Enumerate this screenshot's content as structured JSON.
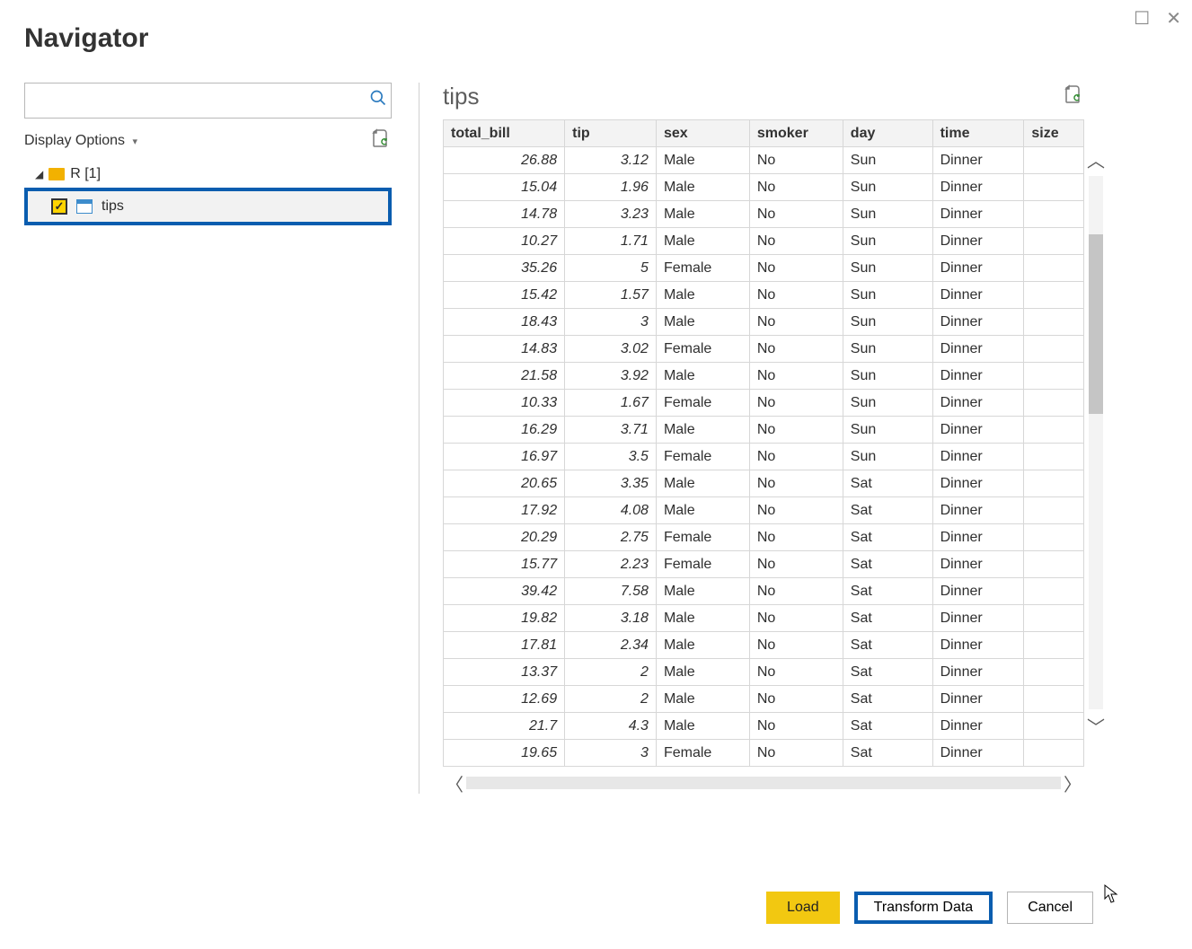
{
  "window": {
    "title": "Navigator"
  },
  "left": {
    "display_options_label": "Display Options",
    "root_label": "R [1]",
    "child_label": "tips",
    "child_checked": true
  },
  "preview": {
    "title": "tips",
    "columns": [
      "total_bill",
      "tip",
      "sex",
      "smoker",
      "day",
      "time",
      "size"
    ],
    "rows": [
      {
        "total_bill": "26.88",
        "tip": "3.12",
        "sex": "Male",
        "smoker": "No",
        "day": "Sun",
        "time": "Dinner",
        "size": ""
      },
      {
        "total_bill": "15.04",
        "tip": "1.96",
        "sex": "Male",
        "smoker": "No",
        "day": "Sun",
        "time": "Dinner",
        "size": ""
      },
      {
        "total_bill": "14.78",
        "tip": "3.23",
        "sex": "Male",
        "smoker": "No",
        "day": "Sun",
        "time": "Dinner",
        "size": ""
      },
      {
        "total_bill": "10.27",
        "tip": "1.71",
        "sex": "Male",
        "smoker": "No",
        "day": "Sun",
        "time": "Dinner",
        "size": ""
      },
      {
        "total_bill": "35.26",
        "tip": "5",
        "sex": "Female",
        "smoker": "No",
        "day": "Sun",
        "time": "Dinner",
        "size": ""
      },
      {
        "total_bill": "15.42",
        "tip": "1.57",
        "sex": "Male",
        "smoker": "No",
        "day": "Sun",
        "time": "Dinner",
        "size": ""
      },
      {
        "total_bill": "18.43",
        "tip": "3",
        "sex": "Male",
        "smoker": "No",
        "day": "Sun",
        "time": "Dinner",
        "size": ""
      },
      {
        "total_bill": "14.83",
        "tip": "3.02",
        "sex": "Female",
        "smoker": "No",
        "day": "Sun",
        "time": "Dinner",
        "size": ""
      },
      {
        "total_bill": "21.58",
        "tip": "3.92",
        "sex": "Male",
        "smoker": "No",
        "day": "Sun",
        "time": "Dinner",
        "size": ""
      },
      {
        "total_bill": "10.33",
        "tip": "1.67",
        "sex": "Female",
        "smoker": "No",
        "day": "Sun",
        "time": "Dinner",
        "size": ""
      },
      {
        "total_bill": "16.29",
        "tip": "3.71",
        "sex": "Male",
        "smoker": "No",
        "day": "Sun",
        "time": "Dinner",
        "size": ""
      },
      {
        "total_bill": "16.97",
        "tip": "3.5",
        "sex": "Female",
        "smoker": "No",
        "day": "Sun",
        "time": "Dinner",
        "size": ""
      },
      {
        "total_bill": "20.65",
        "tip": "3.35",
        "sex": "Male",
        "smoker": "No",
        "day": "Sat",
        "time": "Dinner",
        "size": ""
      },
      {
        "total_bill": "17.92",
        "tip": "4.08",
        "sex": "Male",
        "smoker": "No",
        "day": "Sat",
        "time": "Dinner",
        "size": ""
      },
      {
        "total_bill": "20.29",
        "tip": "2.75",
        "sex": "Female",
        "smoker": "No",
        "day": "Sat",
        "time": "Dinner",
        "size": ""
      },
      {
        "total_bill": "15.77",
        "tip": "2.23",
        "sex": "Female",
        "smoker": "No",
        "day": "Sat",
        "time": "Dinner",
        "size": ""
      },
      {
        "total_bill": "39.42",
        "tip": "7.58",
        "sex": "Male",
        "smoker": "No",
        "day": "Sat",
        "time": "Dinner",
        "size": ""
      },
      {
        "total_bill": "19.82",
        "tip": "3.18",
        "sex": "Male",
        "smoker": "No",
        "day": "Sat",
        "time": "Dinner",
        "size": ""
      },
      {
        "total_bill": "17.81",
        "tip": "2.34",
        "sex": "Male",
        "smoker": "No",
        "day": "Sat",
        "time": "Dinner",
        "size": ""
      },
      {
        "total_bill": "13.37",
        "tip": "2",
        "sex": "Male",
        "smoker": "No",
        "day": "Sat",
        "time": "Dinner",
        "size": ""
      },
      {
        "total_bill": "12.69",
        "tip": "2",
        "sex": "Male",
        "smoker": "No",
        "day": "Sat",
        "time": "Dinner",
        "size": ""
      },
      {
        "total_bill": "21.7",
        "tip": "4.3",
        "sex": "Male",
        "smoker": "No",
        "day": "Sat",
        "time": "Dinner",
        "size": ""
      },
      {
        "total_bill": "19.65",
        "tip": "3",
        "sex": "Female",
        "smoker": "No",
        "day": "Sat",
        "time": "Dinner",
        "size": ""
      }
    ]
  },
  "footer": {
    "load": "Load",
    "transform": "Transform Data",
    "cancel": "Cancel"
  }
}
